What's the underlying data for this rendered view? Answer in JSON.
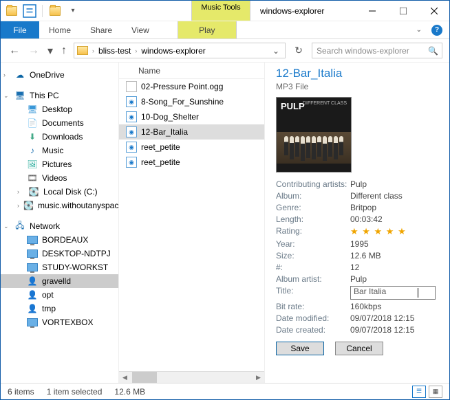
{
  "titlebar": {
    "toolLabel": "Music Tools",
    "title": "windows-explorer"
  },
  "ribbon": {
    "file": "File",
    "tabs": [
      "Home",
      "Share",
      "View"
    ],
    "play": "Play"
  },
  "address": {
    "segments": [
      "bliss-test",
      "windows-explorer"
    ],
    "searchPlaceholder": "Search windows-explorer"
  },
  "nav": {
    "onedrive": "OneDrive",
    "thispc": "This PC",
    "pcItems": [
      "Desktop",
      "Documents",
      "Downloads",
      "Music",
      "Pictures",
      "Videos",
      "Local Disk (C:)",
      "music.withoutanyspace"
    ],
    "network": "Network",
    "netItems": [
      "BORDEAUX",
      "DESKTOP-NDTPJ",
      "STUDY-WORKST",
      "gravelld",
      "opt",
      "tmp",
      "VORTEXBOX"
    ]
  },
  "list": {
    "header": "Name",
    "files": [
      {
        "name": "02-Pressure Point.ogg",
        "audio": false
      },
      {
        "name": "8-Song_For_Sunshine",
        "audio": true
      },
      {
        "name": "10-Dog_Shelter",
        "audio": true
      },
      {
        "name": "12-Bar_Italia",
        "audio": true,
        "sel": true
      },
      {
        "name": "reet_petite",
        "audio": true
      },
      {
        "name": "reet_petite",
        "audio": true
      }
    ]
  },
  "details": {
    "title": "12-Bar_Italia",
    "subtitle": "MP3 File",
    "album_art": {
      "artist": "PULP",
      "sub": "DIFFERENT\nCLASS"
    },
    "props": [
      {
        "label": "Contributing artists:",
        "value": "Pulp"
      },
      {
        "label": "Album:",
        "value": "Different class"
      },
      {
        "label": "Genre:",
        "value": "Britpop"
      },
      {
        "label": "Length:",
        "value": "00:03:42"
      },
      {
        "label": "Rating:",
        "value": "★ ★ ★ ★ ★",
        "stars": true
      },
      {
        "label": "Year:",
        "value": "1995"
      },
      {
        "label": "Size:",
        "value": "12.6 MB"
      },
      {
        "label": "#:",
        "value": "12"
      },
      {
        "label": "Album artist:",
        "value": "Pulp"
      },
      {
        "label": "Title:",
        "value": "Bar Italia",
        "edit": true
      },
      {
        "label": "Bit rate:",
        "value": "160kbps"
      },
      {
        "label": "Date modified:",
        "value": "09/07/2018 12:15"
      },
      {
        "label": "Date created:",
        "value": "09/07/2018 12:15"
      }
    ],
    "save": "Save",
    "cancel": "Cancel"
  },
  "status": {
    "count": "6 items",
    "sel": "1 item selected",
    "size": "12.6 MB"
  }
}
